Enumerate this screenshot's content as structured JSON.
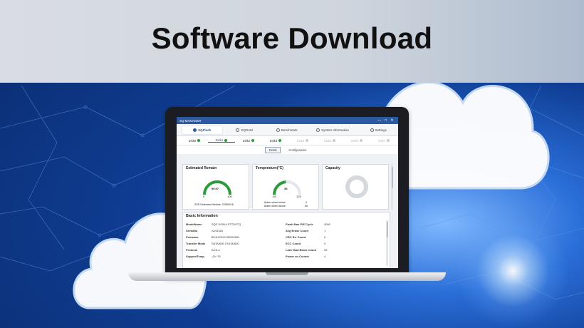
{
  "banner": {
    "title": "Software Download",
    "colors": {
      "header_band": "#d4d9e0",
      "background": "#0f3d93",
      "cloud": "#ffffff",
      "laptop_frame": "#1b1d22"
    }
  },
  "app": {
    "window_title": "SQ MANAGER",
    "window_controls": [
      "—",
      "□",
      "✕"
    ],
    "main_tabs": [
      {
        "label": "SQFlash",
        "icon": "sqflash-icon",
        "active": true
      },
      {
        "label": "SQRAM",
        "icon": "sqram-icon",
        "active": false
      },
      {
        "label": "Benchmark",
        "icon": "benchmark-icon",
        "active": false
      },
      {
        "label": "System Information",
        "icon": "info-icon",
        "active": false
      },
      {
        "label": "Settings",
        "icon": "gear-icon",
        "active": false
      }
    ],
    "disk_tabs": [
      {
        "label": "Disk0",
        "active": false,
        "disabled": false
      },
      {
        "label": "Disk1",
        "active": true,
        "disabled": false
      },
      {
        "label": "Disk2",
        "active": false,
        "disabled": false
      },
      {
        "label": "Disk3",
        "active": false,
        "disabled": false
      },
      {
        "label": "Disk4",
        "active": false,
        "disabled": true
      },
      {
        "label": "Disk5",
        "active": false,
        "disabled": true
      },
      {
        "label": "Disk6",
        "active": false,
        "disabled": true
      },
      {
        "label": "Disk7",
        "active": false,
        "disabled": true
      }
    ],
    "sub_tabs": [
      {
        "label": "Detail",
        "active": true
      },
      {
        "label": "Configuration",
        "active": false
      }
    ],
    "estimated_remain": {
      "title": "Estimated Remain",
      "value": "99.97",
      "min": "0",
      "max": "100",
      "fraction": 0.9997,
      "footer": "SSD Estimated lifetime: 2038/5/16",
      "color": "#2e9a3e"
    },
    "temperature": {
      "title": "Temperature(°C)",
      "value": "35",
      "min": "-45",
      "max": "125",
      "fraction": 0.47,
      "alarm_below_label": "Alarm when below:",
      "alarm_below_value": "0",
      "alarm_above_label": "Alarm when above:",
      "alarm_above_value": "55",
      "color": "#2e9a3e"
    },
    "capacity": {
      "title": "Capacity",
      "ring_color": "#d5d8dc"
    },
    "basic_info": {
      "title": "Basic Information",
      "rows": [
        {
          "k1": "ModelName",
          "v1": "SQF-S25V4-P7TDSTQ",
          "k2": "Flash Max P/E Cycle",
          "v2": "3000"
        },
        {
          "k1": "SerialNo",
          "v1": "S24115A",
          "k2": "Avg Erase Count",
          "v2": "1"
        },
        {
          "k1": "Firmware",
          "v1": "BCA12310190220004",
          "k2": "CRC Err Count",
          "v2": "0"
        },
        {
          "k1": "Transfer Mode",
          "v1": "SATA/600 | SATA/600",
          "k2": "ECC Count",
          "v2": "0"
        },
        {
          "k1": "Protocol",
          "v1": "ACS-2",
          "k2": "Later Bad Block Count",
          "v2": "25"
        },
        {
          "k1": "SupportTemp.",
          "v1": "-20~75",
          "k2": "Power on Counts",
          "v2": "4"
        }
      ]
    }
  }
}
